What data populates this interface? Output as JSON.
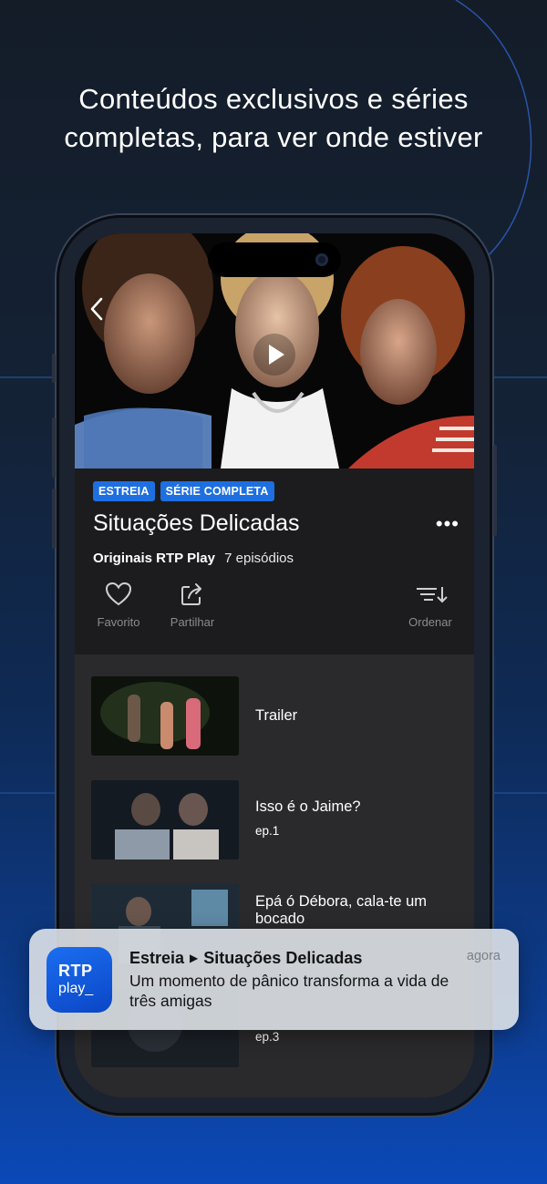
{
  "headline": {
    "line1": "Conteúdos exclusivos e séries",
    "line2": "completas, para ver onde estiver"
  },
  "show": {
    "badges": [
      "ESTREIA",
      "SÉRIE COMPLETA"
    ],
    "title": "Situações Delicadas",
    "producer": "Originais RTP Play",
    "episode_count": "7 episódios",
    "more_icon": "ellipsis-icon"
  },
  "actions": {
    "favorite": "Favorito",
    "share": "Partilhar",
    "sort": "Ordenar"
  },
  "episodes": [
    {
      "title": "Trailer",
      "number": ""
    },
    {
      "title": "Isso é o Jaime?",
      "number": "ep.1"
    },
    {
      "title": "Epá ó Débora, cala-te um bocado",
      "number": ""
    },
    {
      "title": "",
      "number": "ep.3"
    }
  ],
  "notification": {
    "app_icon_text_1": "RTP",
    "app_icon_text_2": "play_",
    "category": "Estreia",
    "show_title": "Situações Delicadas",
    "time": "agora",
    "body": "Um momento de pânico transforma a vida de três amigas"
  },
  "colors": {
    "accent": "#1e6fe0",
    "screen_bg": "#1c1c1e",
    "episode_list_bg": "#2a2a2c"
  }
}
